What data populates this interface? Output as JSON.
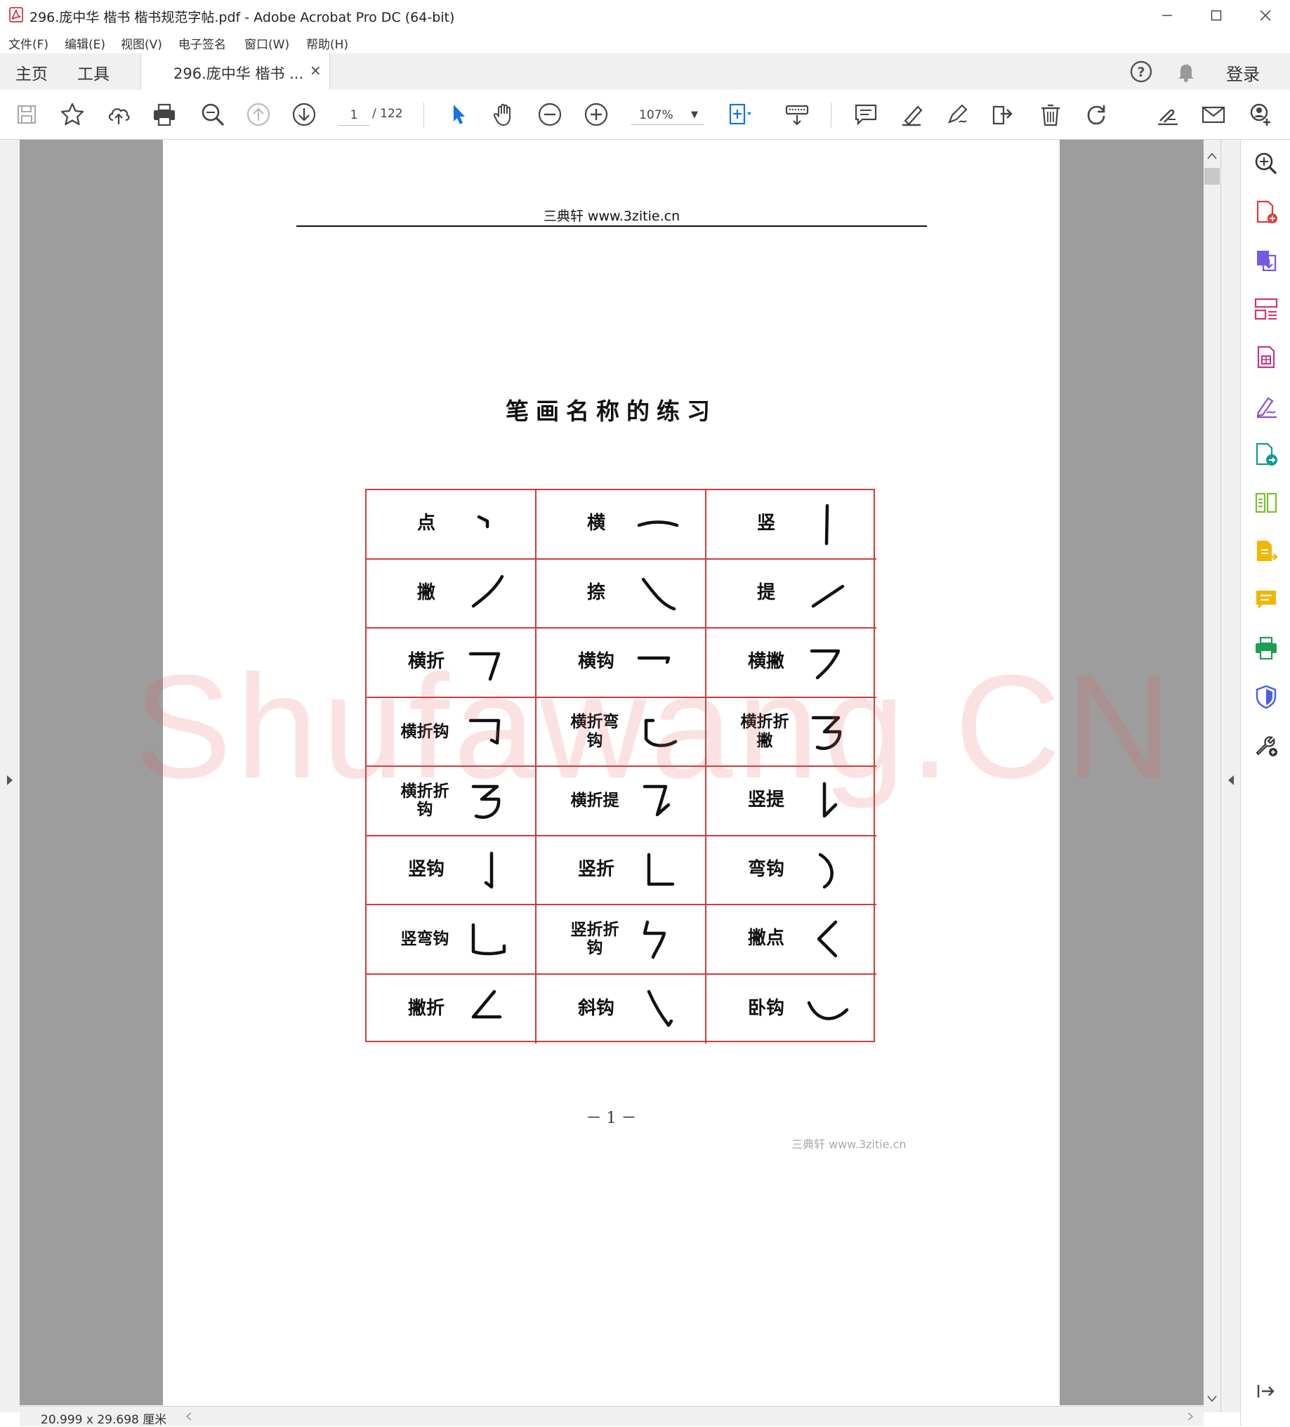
{
  "window": {
    "title": "296.庞中华 楷书 楷书规范字帖.pdf - Adobe Acrobat Pro DC (64-bit)",
    "minimize_icon": "minimize-icon",
    "maximize_icon": "maximize-icon",
    "close_icon": "close-icon"
  },
  "menu": [
    "文件(F)",
    "编辑(E)",
    "视图(V)",
    "电子签名",
    "窗口(W)",
    "帮助(H)"
  ],
  "tabs": {
    "home": "主页",
    "tools": "工具",
    "document": "296.庞中华 楷书 ...",
    "document_close": "×",
    "login": "登录"
  },
  "toolbar": {
    "page_current": "1",
    "page_total": "/ 122",
    "zoom": "107%",
    "accent_color": "#1473e6"
  },
  "page": {
    "header": "三典轩 www.3zitie.cn",
    "title": "笔画名称的练习",
    "strokes": [
      [
        "点",
        "横",
        "竖"
      ],
      [
        "撇",
        "捺",
        "提"
      ],
      [
        "横折",
        "横钩",
        "横撇"
      ],
      [
        "横折钩",
        "横折弯钩",
        "横折折撇"
      ],
      [
        "横折折钩",
        "横折提",
        "竖提"
      ],
      [
        "竖钩",
        "竖折",
        "弯钩"
      ],
      [
        "竖弯钩",
        "竖折折钩",
        "撇点"
      ],
      [
        "撇折",
        "斜钩",
        "卧钩"
      ]
    ],
    "page_number": "－ 1 －",
    "footer": "三典轩 www.3zitie.cn",
    "grid_color": "#d13a3a"
  },
  "watermark": "Shufawang.CN",
  "status": {
    "dimensions": "20.999 x 29.698 厘米"
  }
}
